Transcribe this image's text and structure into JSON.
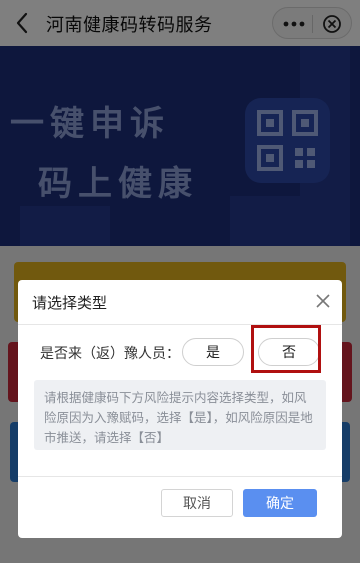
{
  "header": {
    "title": "河南健康码转码服务",
    "back_icon": "chevron-left-icon",
    "more_icon": "more-dots-icon",
    "close_icon": "circle-close-icon"
  },
  "banner": {
    "line1": "一键申诉",
    "line2": "码上健康",
    "colors": {
      "bg": "#1d2f7a",
      "text": "#8fa0d9"
    },
    "qr_icon": "qr-code-icon"
  },
  "dialog": {
    "title": "请选择类型",
    "close_icon": "close-icon",
    "question": "是否来（返）豫人员：",
    "options": [
      {
        "label": "是"
      },
      {
        "label": "否"
      }
    ],
    "hint": "请根据健康码下方风险提示内容选择类型，如风险原因为入豫赋码，选择【是】，如风险原因是地市推送，请选择【否】",
    "cancel_label": "取消",
    "confirm_label": "确定",
    "colors": {
      "confirm": "#5a8ff0",
      "highlight_box": "#b01010"
    }
  },
  "background_cards": {
    "colors": [
      "#e3b31d",
      "#c8283a",
      "#2d7bd1"
    ]
  }
}
